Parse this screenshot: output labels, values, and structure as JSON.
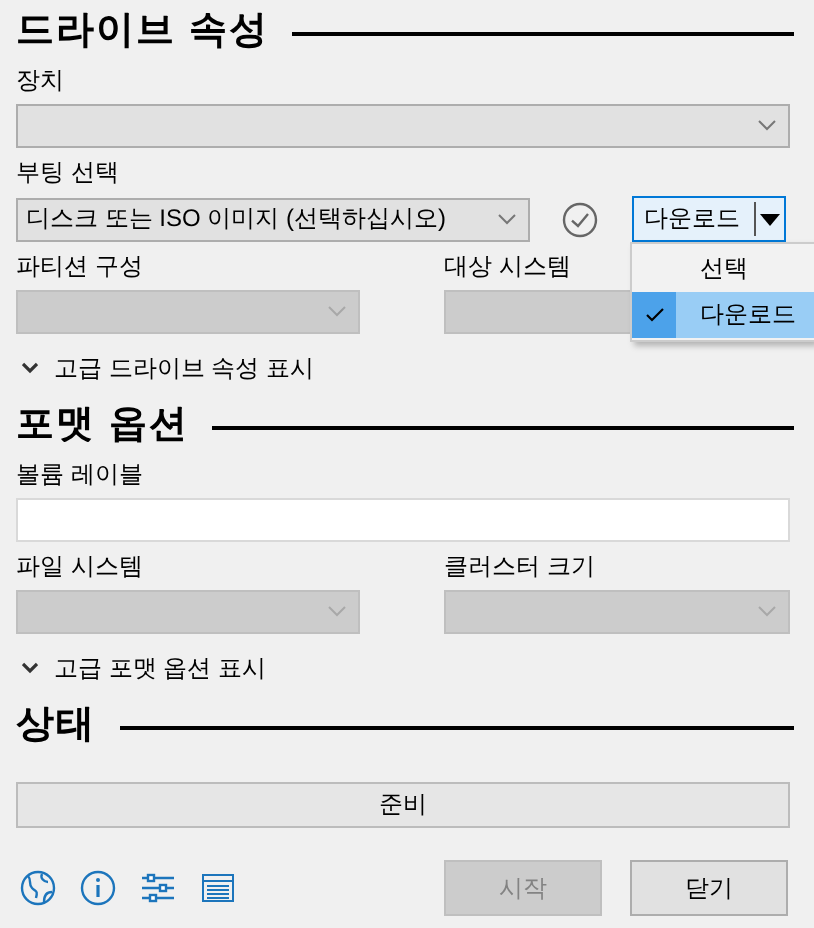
{
  "drive_properties": {
    "title": "드라이브 속성",
    "device": {
      "label": "장치",
      "disabled": false
    },
    "boot_selection": {
      "label": "부팅 선택",
      "value": "디스크 또는 ISO 이미지 (선택하십시오)",
      "disabled": false,
      "button": "다운로드",
      "menu": [
        {
          "label": "선택",
          "selected": false
        },
        {
          "label": "다운로드",
          "selected": true
        }
      ]
    },
    "partition_scheme": {
      "label": "파티션 구성",
      "disabled": true
    },
    "target_system": {
      "label": "대상 시스템",
      "disabled": true
    },
    "advanced_toggle": {
      "label": "고급 드라이브 속성 표시",
      "expanded": false
    }
  },
  "format_options": {
    "title": "포맷 옵션",
    "volume_label": {
      "label": "볼륨 레이블"
    },
    "file_system": {
      "label": "파일 시스템",
      "disabled": true
    },
    "cluster_size": {
      "label": "클러스터 크기",
      "disabled": true
    },
    "advanced_toggle": {
      "label": "고급 포맷 옵션 표시",
      "expanded": false
    }
  },
  "status": {
    "title": "상태",
    "text": "준비"
  },
  "footer": {
    "buttons": [
      {
        "label": "시작",
        "disabled": true
      },
      {
        "label": "닫기",
        "disabled": false
      }
    ]
  }
}
